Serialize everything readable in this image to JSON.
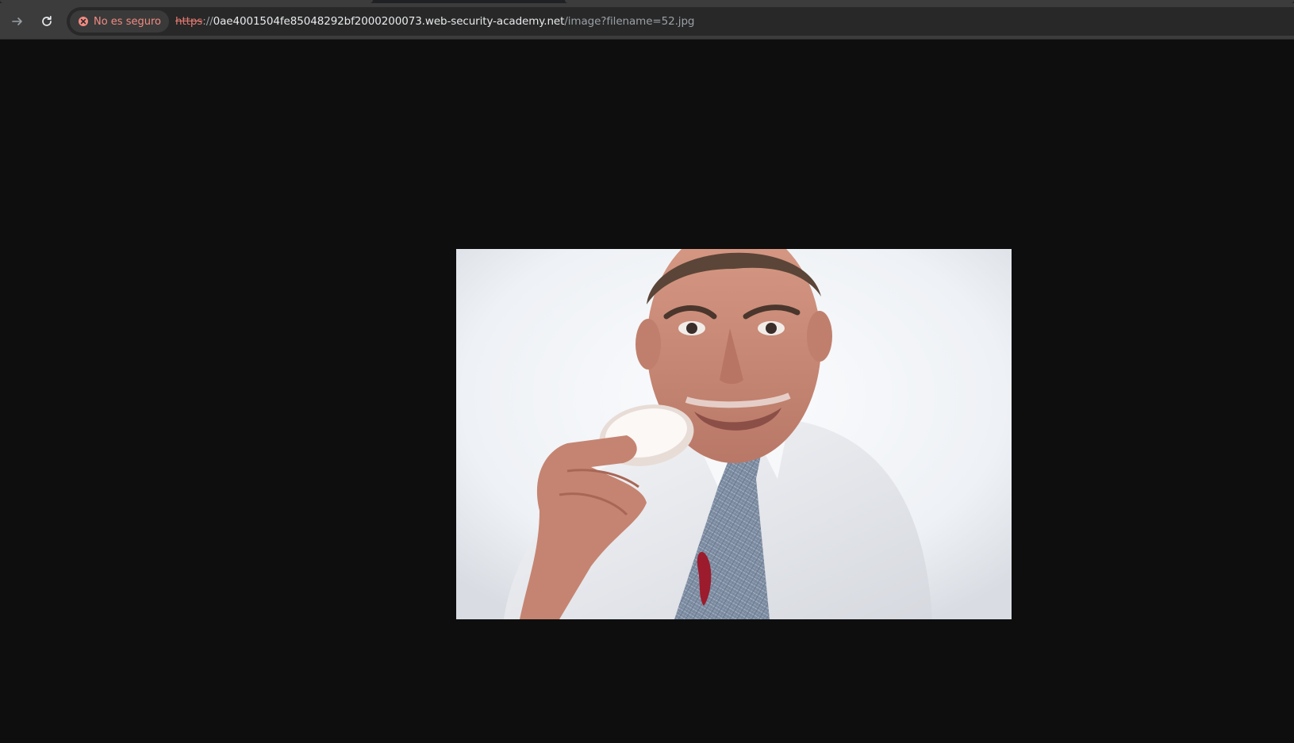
{
  "browser": {
    "nav": {
      "forward_icon": "arrow-right-icon",
      "reload_icon": "reload-icon"
    },
    "security": {
      "icon": "insecure-x-icon",
      "label": "No es seguro",
      "color": "#f28b82"
    },
    "address": {
      "scheme": "https",
      "separator": "://",
      "host": "0ae4001504fe85048292bf2000200073.web-security-academy.net",
      "path": "/image?filename=52.jpg"
    }
  },
  "page": {
    "background": "#0e0e0e",
    "image": {
      "description_icon": "photo-man-eating-jam-donut"
    }
  }
}
